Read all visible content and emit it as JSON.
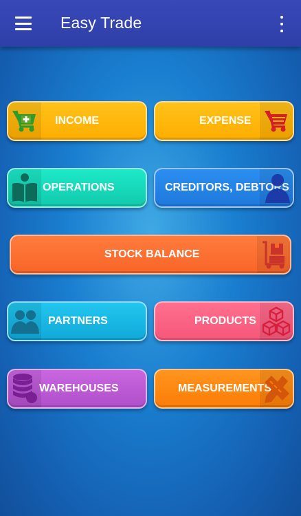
{
  "appbar": {
    "title": "Easy Trade",
    "menu_icon": "hamburger-menu-icon",
    "overflow_icon": "more-vertical-icon"
  },
  "tiles": {
    "income": {
      "label": "INCOME",
      "icon": "cart-add-icon",
      "color": "#ffb300"
    },
    "expense": {
      "label": "EXPENSE",
      "icon": "cart-icon",
      "color": "#ffb300"
    },
    "operations": {
      "label": "OPERATIONS",
      "icon": "person-reading-icon",
      "color": "#12d6b6"
    },
    "creditors": {
      "label": "CREDITORS, DEBTORS",
      "icon": "person-icon",
      "color": "#2384e6"
    },
    "stock": {
      "label": "STOCK BALANCE",
      "icon": "hand-truck-box-icon",
      "color": "#fa6e30"
    },
    "partners": {
      "label": "PARTNERS",
      "icon": "people-icon",
      "color": "#18b8e4"
    },
    "products": {
      "label": "PRODUCTS",
      "icon": "cubes-icon",
      "color": "#f86484"
    },
    "warehouses": {
      "label": "WAREHOUSES",
      "icon": "database-icon",
      "color": "#bd5ad6"
    },
    "measurements": {
      "label": "MEASUREMENTS",
      "icon": "ruler-pencil-icon",
      "color": "#fd8812"
    }
  }
}
